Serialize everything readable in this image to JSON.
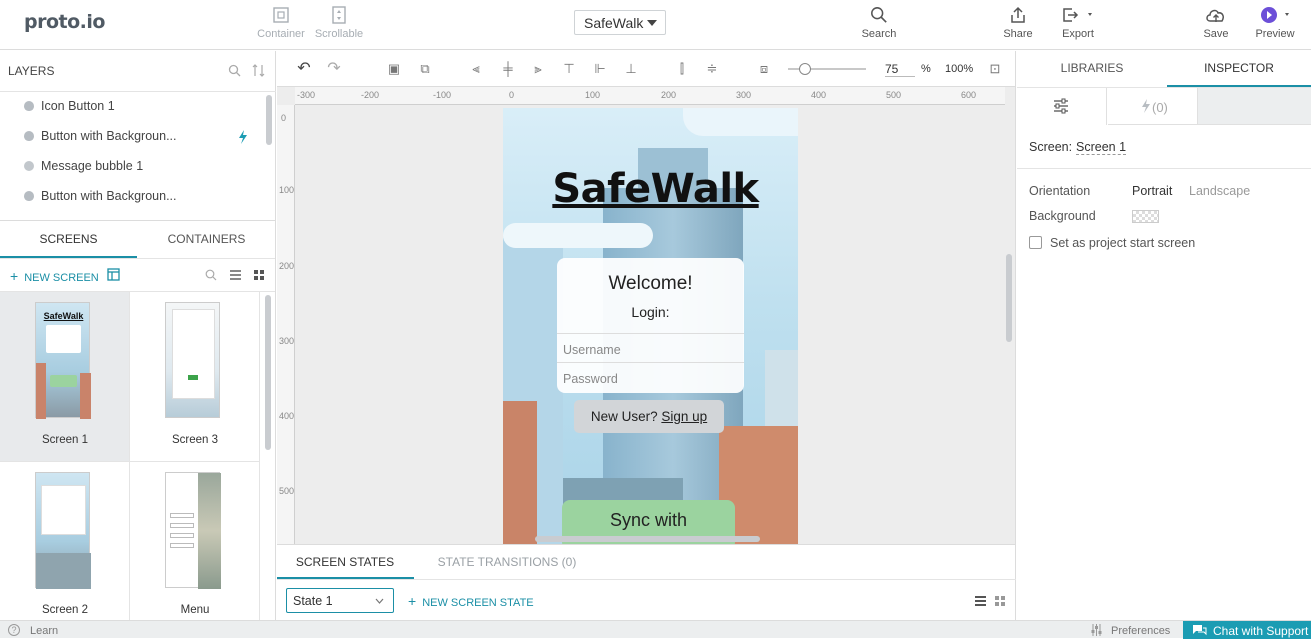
{
  "app": {
    "logo": "proto.io"
  },
  "toolbar": {
    "container_label": "Container",
    "scrollable_label": "Scrollable",
    "project_name": "SafeWalk",
    "search_label": "Search",
    "share_label": "Share",
    "export_label": "Export",
    "save_label": "Save",
    "preview_label": "Preview"
  },
  "layers": {
    "title": "LAYERS",
    "items": [
      {
        "label": "Icon Button 1",
        "icon": "apple-icon"
      },
      {
        "label": "Button with Backgroun...",
        "icon": "apple-icon",
        "interaction": true
      },
      {
        "label": "Message bubble 1",
        "icon": "speech-bubble-icon"
      },
      {
        "label": "Button with Backgroun...",
        "icon": "apple-icon"
      }
    ]
  },
  "screens_panel": {
    "tabs": [
      "SCREENS",
      "CONTAINERS"
    ],
    "new_screen_label": "NEW SCREEN",
    "screens": [
      {
        "label": "Screen 1",
        "selected": true
      },
      {
        "label": "Screen 3",
        "selected": false
      },
      {
        "label": "Screen 2",
        "selected": false
      },
      {
        "label": "Menu",
        "selected": false
      }
    ]
  },
  "canvas": {
    "zoom_value": "75",
    "zoom_unit": "%",
    "zoom_fit": "100%",
    "ruler_h": [
      "-300",
      "-200",
      "-100",
      "0",
      "100",
      "200",
      "300",
      "400",
      "500",
      "600"
    ],
    "ruler_v": [
      "0",
      "100",
      "200",
      "300",
      "400",
      "500"
    ]
  },
  "phone": {
    "title": "SafeWalk",
    "welcome": "Welcome!",
    "login_label": "Login:",
    "username_placeholder": "Username",
    "password_placeholder": "Password",
    "new_user_text": "New User?",
    "sign_up_text": "Sign up",
    "sync_text": "Sync with"
  },
  "states": {
    "tabs": [
      "SCREEN STATES",
      "STATE TRANSITIONS (0)"
    ],
    "current_state": "State 1",
    "new_state_label": "NEW SCREEN STATE"
  },
  "inspector": {
    "tabs": [
      "LIBRARIES",
      "INSPECTOR"
    ],
    "interactions_count": "(0)",
    "screen_label": "Screen:",
    "screen_name": "Screen 1",
    "orientation_label": "Orientation",
    "orientation_options": [
      "Portrait",
      "Landscape"
    ],
    "background_label": "Background",
    "start_screen_label": "Set as project start screen"
  },
  "statusbar": {
    "learn_label": "Learn",
    "preferences_label": "Preferences",
    "chat_label": "Chat with Support"
  },
  "colors": {
    "accent": "#1b8fa6",
    "chat": "#1b9cb3",
    "sync_button": "#9bd39f"
  }
}
